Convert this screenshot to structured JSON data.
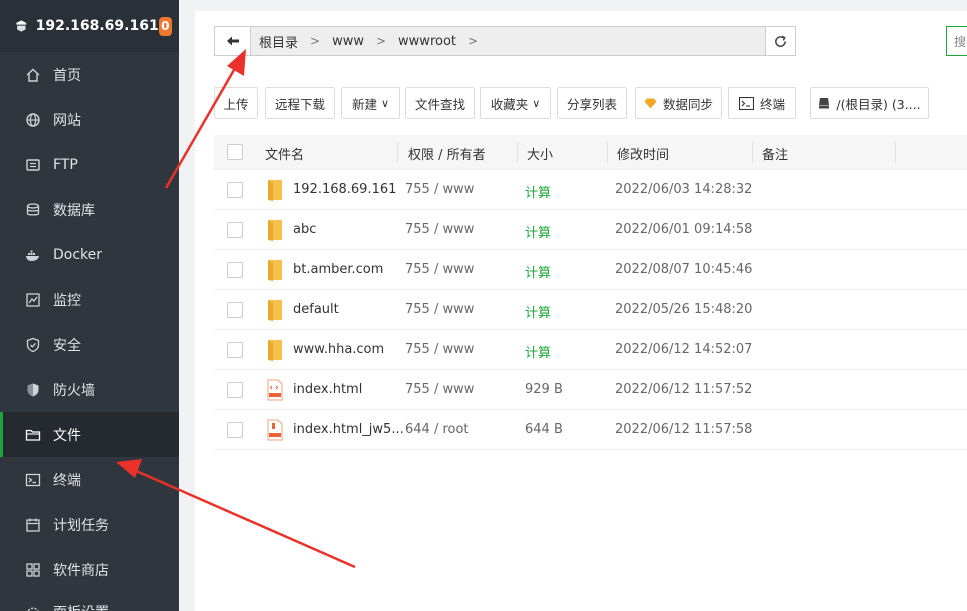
{
  "sidebar": {
    "server_ip": "192.168.69.161",
    "badge": "0",
    "items": [
      {
        "label": "首页",
        "icon": "home-icon"
      },
      {
        "label": "网站",
        "icon": "globe-icon"
      },
      {
        "label": "FTP",
        "icon": "ftp-icon"
      },
      {
        "label": "数据库",
        "icon": "database-icon"
      },
      {
        "label": "Docker",
        "icon": "docker-icon"
      },
      {
        "label": "监控",
        "icon": "monitor-icon"
      },
      {
        "label": "安全",
        "icon": "shield-check-icon"
      },
      {
        "label": "防火墙",
        "icon": "firewall-icon"
      },
      {
        "label": "文件",
        "icon": "folder-icon",
        "active": true
      },
      {
        "label": "终端",
        "icon": "terminal-icon"
      },
      {
        "label": "计划任务",
        "icon": "calendar-icon"
      },
      {
        "label": "软件商店",
        "icon": "store-icon"
      },
      {
        "label": "面板设置",
        "icon": "settings-icon"
      }
    ]
  },
  "path": {
    "crumbs": [
      "根目录",
      "www",
      "wwwroot"
    ],
    "search_placeholder": "搜"
  },
  "toolbar": {
    "upload": "上传",
    "remote_download": "远程下载",
    "new": "新建",
    "file_search": "文件查找",
    "favorites": "收藏夹",
    "share_list": "分享列表",
    "data_sync": "数据同步",
    "terminal": "终端",
    "disk": "/(根目录) (3...."
  },
  "table": {
    "headers": {
      "name": "文件名",
      "perm": "权限 / 所有者",
      "size": "大小",
      "mtime": "修改时间",
      "note": "备注"
    },
    "rows": [
      {
        "name": "192.168.69.161",
        "type": "folder",
        "perm": "755 / www",
        "size": "计算",
        "mtime": "2022/06/03 14:28:32"
      },
      {
        "name": "abc",
        "type": "folder",
        "perm": "755 / www",
        "size": "计算",
        "mtime": "2022/06/01 09:14:58"
      },
      {
        "name": "bt.amber.com",
        "type": "folder",
        "perm": "755 / www",
        "size": "计算",
        "mtime": "2022/08/07 10:45:46"
      },
      {
        "name": "default",
        "type": "folder",
        "perm": "755 / www",
        "size": "计算",
        "mtime": "2022/05/26 15:48:20"
      },
      {
        "name": "www.hha.com",
        "type": "folder",
        "perm": "755 / www",
        "size": "计算",
        "mtime": "2022/06/12 14:52:07"
      },
      {
        "name": "index.html",
        "type": "html",
        "perm": "755 / www",
        "size": "929 B",
        "mtime": "2022/06/12 11:57:52"
      },
      {
        "name": "index.html_jw5...",
        "type": "swp",
        "perm": "644 / root",
        "size": "644 B",
        "mtime": "2022/06/12 11:57:58"
      }
    ]
  },
  "colors": {
    "sidebar_bg": "#30363e",
    "accent_green": "#20a53a",
    "badge_orange": "#f0772f",
    "annotation_red": "#e8322a",
    "folder_yellow": "#f5c24d"
  }
}
